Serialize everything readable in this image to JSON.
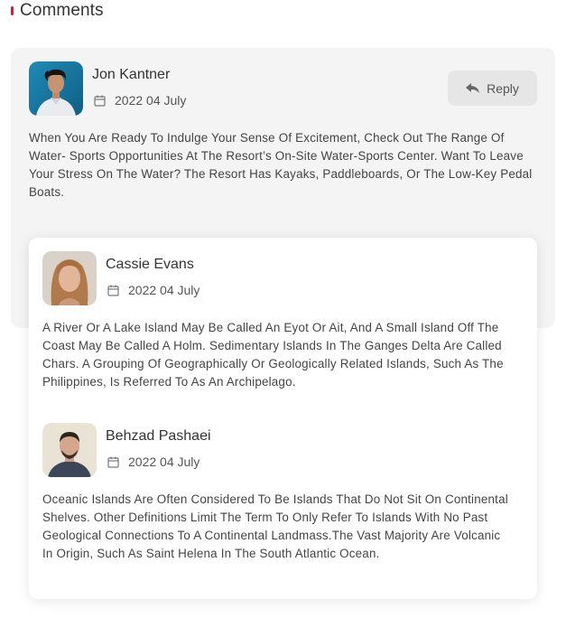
{
  "section": {
    "title": "Comments"
  },
  "comments": [
    {
      "name": "Jon Kantner",
      "date": "2022 04 July",
      "text": "When You Are Ready To Indulge Your Sense Of Excitement, Check Out The Range Of Water- Sports Opportunities At The Resort’s On-Site Water-Sports Center. Want To Leave Your Stress On The Water? The Resort Has Kayaks, Paddleboards, Or The Low-Key Pedal Boats.",
      "reply_label": "Reply"
    },
    {
      "name": "Cassie Evans",
      "date": "2022 04 July",
      "text": "A River Or A Lake Island May Be Called An Eyot Or Ait, And A Small Island Off The Coast May Be Called A Holm. Sedimentary Islands In The Ganges Delta Are Called Chars. A Grouping Of Geographically Or Geologically Related Islands, Such As The Philippines, Is Referred To As An Archipelago."
    },
    {
      "name": "Behzad Pashaei",
      "date": "2022 04 July",
      "text": "Oceanic Islands Are Often Considered To Be Islands That Do Not Sit On Continental Shelves. Other Definitions Limit The Term To Only Refer To Islands With No Past Geological Connections To A Continental Landmass.The Vast Majority Are Volcanic In Origin, Such As Saint Helena In The South Atlantic Ocean."
    }
  ],
  "colors": {
    "accent": "#e0192d",
    "card_bg": "#f4f4f4",
    "reply_bg": "#e6e6e6"
  },
  "icons": {
    "calendar": "calendar-icon",
    "reply": "reply-arrow-icon"
  }
}
